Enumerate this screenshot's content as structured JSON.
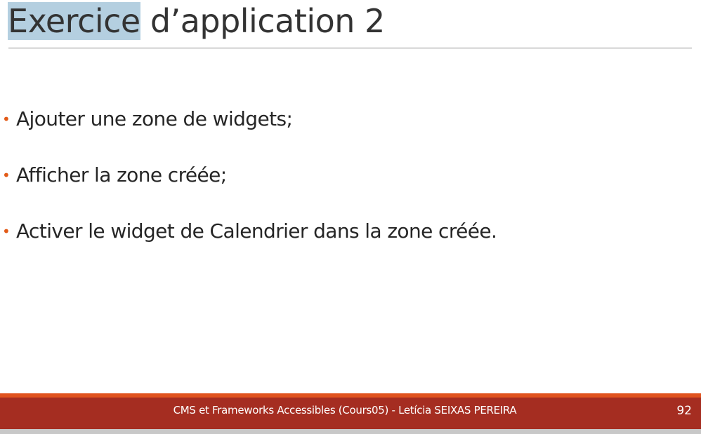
{
  "slide": {
    "title_highlighted": "Exercice",
    "title_rest": " d’application 2",
    "bullet_marker": "•",
    "bullets": [
      "Ajouter une zone de widgets;",
      "Afficher la zone créée;",
      "Activer le widget de Calendrier dans la zone créée."
    ]
  },
  "footer": {
    "text": "CMS et Frameworks Accessibles (Cours05) - Letícia SEIXAS PEREIRA",
    "page_number": "92"
  },
  "colors": {
    "bullet_accent": "#e25a17",
    "footer_band": "#a52d21",
    "footer_accent": "#e0531e",
    "title_selection": "#b4cfe0"
  }
}
